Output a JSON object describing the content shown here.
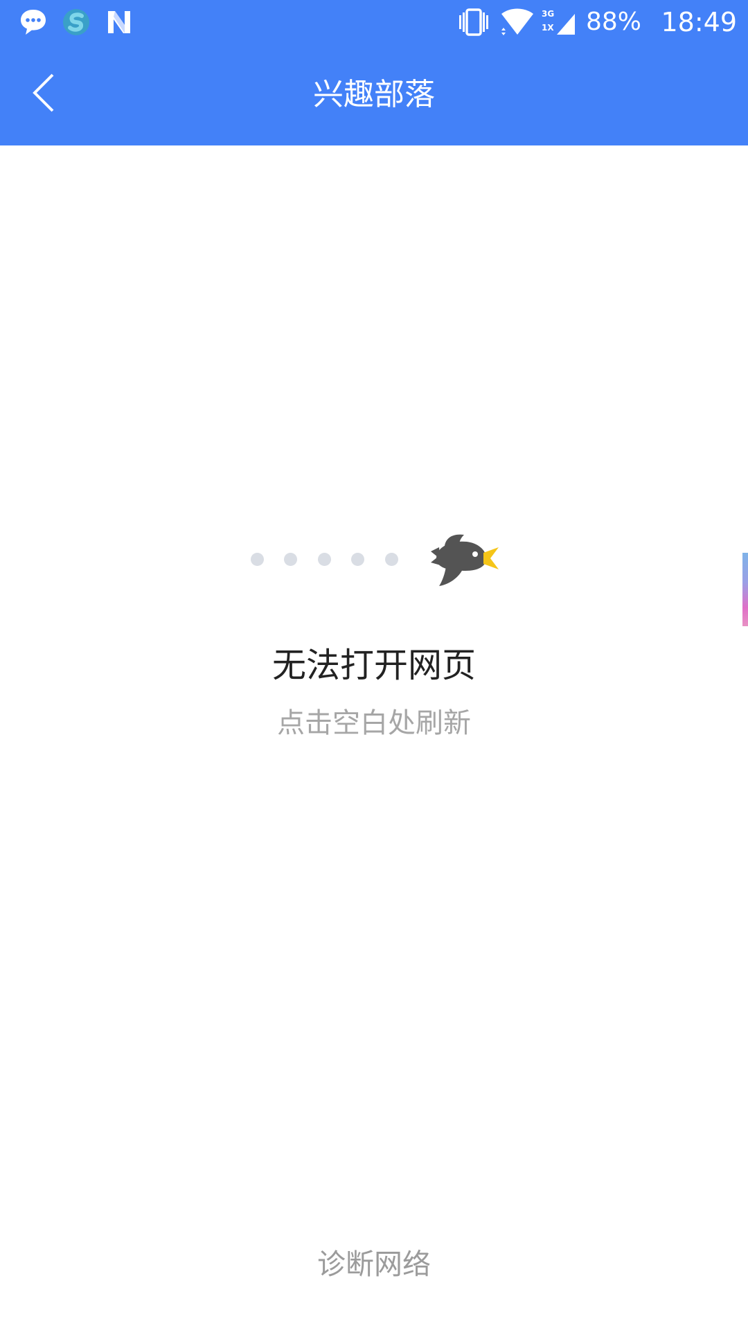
{
  "status_bar": {
    "icons_left": [
      "chat-bubble-icon",
      "s-app-icon",
      "n-app-icon"
    ],
    "network_type_top": "3G",
    "network_type_bottom": "1X",
    "battery": "88%",
    "time": "18:49"
  },
  "title_bar": {
    "back_icon": "chevron-left-icon",
    "title": "兴趣部落"
  },
  "error": {
    "illustration": "bird-icon",
    "loading_dots": 5,
    "title": "无法打开网页",
    "subtitle": "点击空白处刷新"
  },
  "footer": {
    "diagnose_label": "诊断网络"
  },
  "colors": {
    "header": "#4381f8",
    "title_text": "#ffffff",
    "error_title": "#222222",
    "hint_text": "#a6a6a6",
    "dot": "#d9dde4",
    "bird_body": "#545454",
    "bird_beak": "#f5c518"
  }
}
